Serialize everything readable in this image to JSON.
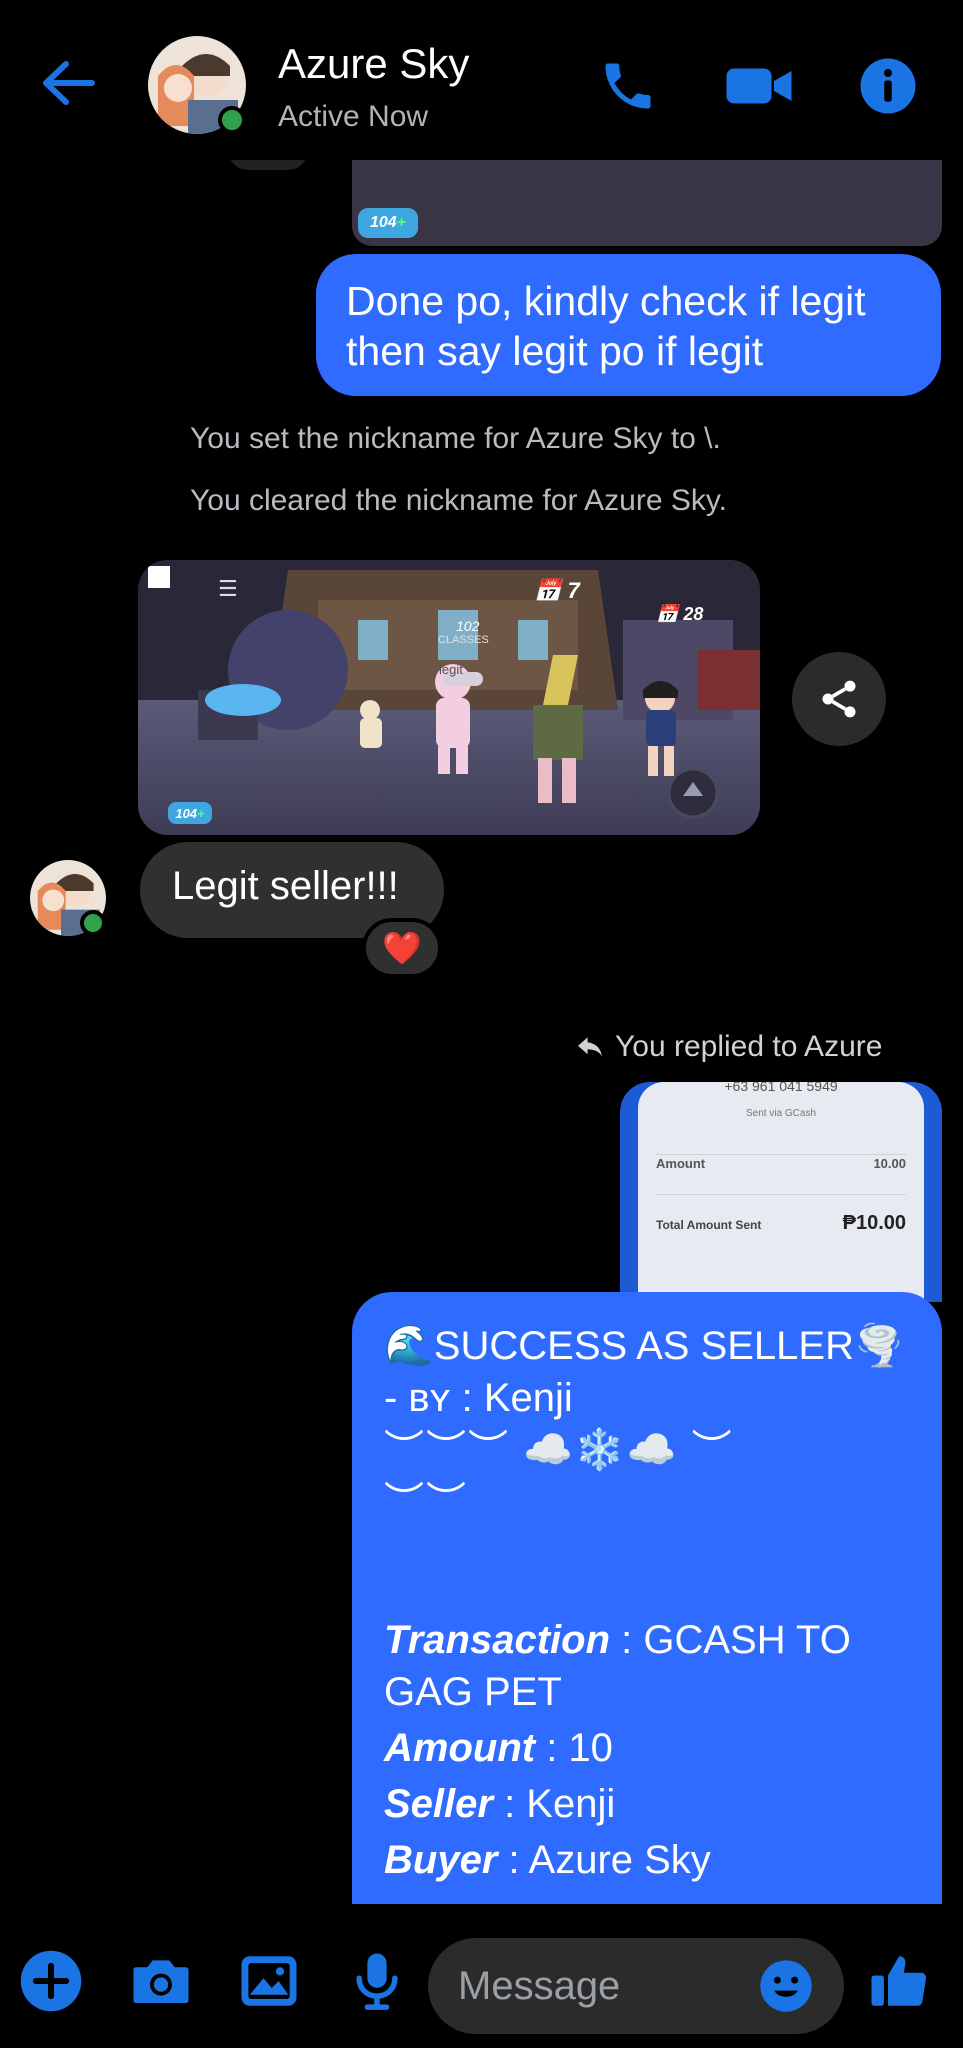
{
  "header": {
    "contact_name": "Azure Sky",
    "status": "Active Now",
    "accent": "#1b74e4"
  },
  "messages": {
    "top_image_badge": "104",
    "outgoing_text": "Done po, kindly check if legit then say legit po if legit",
    "system_1": "You set the nickname for Azure Sky to \\.",
    "system_2": "You cleared the nickname for Azure Sky.",
    "game_image": {
      "badge": "104",
      "counter_1": "7",
      "counter_2": "28",
      "overlay_1": "102",
      "overlay_2": "CLASSES",
      "overlay_3": "legit"
    },
    "incoming_text": "Legit seller!!!",
    "reaction": "❤️",
    "reply_note": "You replied to Azure",
    "receipt": {
      "phone": "+63 961 041 5949",
      "sent_via": "Sent via GCash",
      "amount_label": "Amount",
      "amount_value": "10.00",
      "total_label": "Total Amount Sent",
      "total_value": "₱10.00"
    },
    "success_post": {
      "title": "🌊SUCCESS AS SELLER🌪️",
      "by_prefix": "- ʙʏ : ",
      "by_name": "Kenji",
      "deco_line_1": "︶︶︶ ☁️❄️☁️ ︶",
      "deco_line_2": "︶︶",
      "transaction_label": "Transaction",
      "transaction_value": " : GCASH TO GAG PET",
      "amount_label": "Amount",
      "amount_value": " :  10",
      "seller_label": "Seller",
      "seller_value": " : Kenji",
      "buyer_label": "Buyer",
      "buyer_value": " : Azure Sky"
    }
  },
  "composer": {
    "placeholder": "Message"
  },
  "icons": {
    "back": "arrow-left-icon",
    "call": "phone-icon",
    "video": "video-camera-icon",
    "info": "info-icon",
    "add": "plus-circle-icon",
    "camera": "camera-icon",
    "gallery": "image-icon",
    "mic": "microphone-icon",
    "emoji": "emoji-icon",
    "like": "thumbs-up-icon"
  }
}
